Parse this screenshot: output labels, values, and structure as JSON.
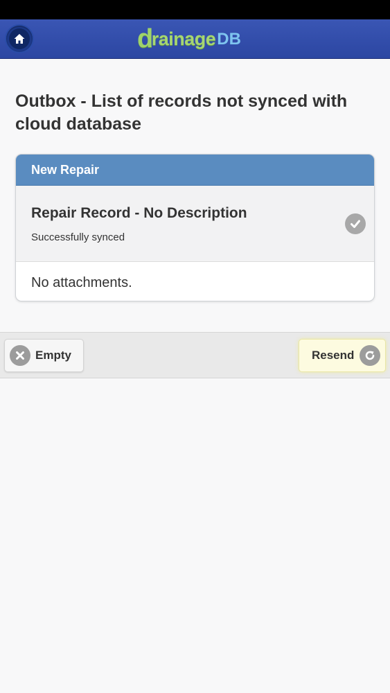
{
  "header": {
    "logo_initial": "d",
    "logo_rest": "rainage",
    "logo_suffix": "DB",
    "home_icon": "home-icon"
  },
  "page": {
    "title": "Outbox - List of records not synced with cloud database"
  },
  "card": {
    "header": "New Repair",
    "record_title": "Repair Record - No Description",
    "record_status": "Successfully synced",
    "attachments": "No attachments.",
    "status_icon": "check-icon"
  },
  "footer": {
    "empty_label": "Empty",
    "resend_label": "Resend",
    "empty_icon": "close-icon",
    "resend_icon": "refresh-icon"
  },
  "colors": {
    "header_bg": "#2f4aa8",
    "card_header_bg": "#5a8cc0",
    "resend_bg": "#fdfbe0",
    "logo_green": "#a6d672",
    "logo_blue": "#7ec4ef"
  }
}
